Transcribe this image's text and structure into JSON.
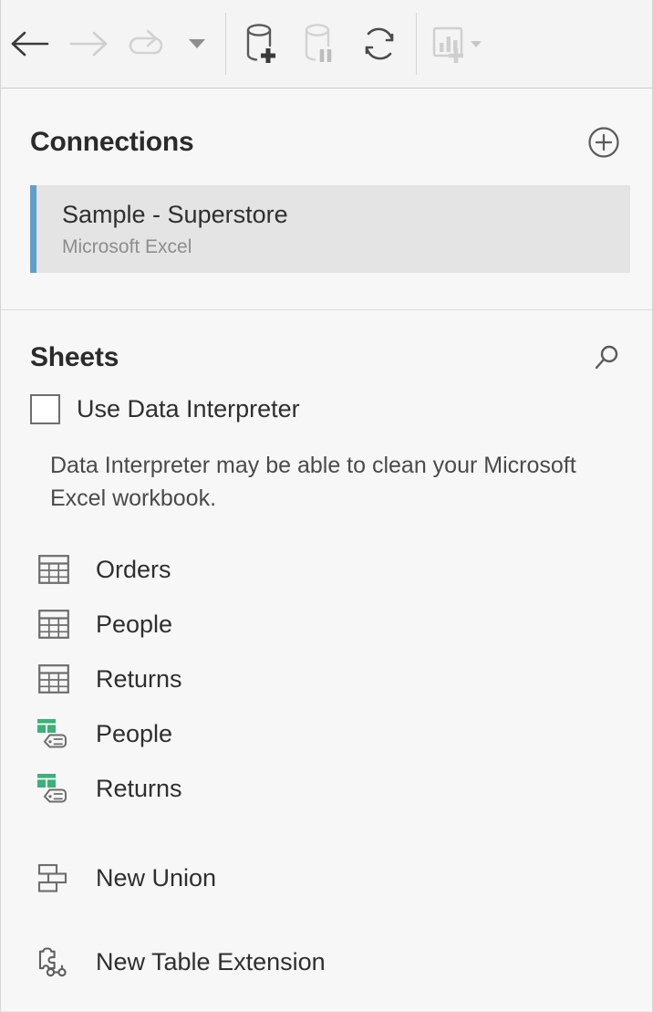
{
  "toolbar": {
    "buttons": [
      {
        "name": "back",
        "icon": "arrow-left-icon",
        "enabled": true
      },
      {
        "name": "forward",
        "icon": "arrow-right-icon",
        "enabled": false
      },
      {
        "name": "refresh-data-source",
        "icon": "redo-arrow-icon",
        "enabled": false
      },
      {
        "name": "refresh-dropdown",
        "icon": "caret-down-icon",
        "enabled": true
      },
      {
        "name": "add-new-data-source",
        "icon": "database-plus-icon",
        "enabled": true
      },
      {
        "name": "pause-auto-update",
        "icon": "database-pause-icon",
        "enabled": false
      },
      {
        "name": "refresh-data",
        "icon": "refresh-circular-icon",
        "enabled": true
      },
      {
        "name": "new-worksheet",
        "icon": "new-worksheet-icon",
        "enabled": false
      }
    ]
  },
  "connections": {
    "title": "Connections",
    "add_button_icon": "plus-circle-icon",
    "items": [
      {
        "name": "Sample - Superstore",
        "type": "Microsoft Excel",
        "selected": true
      }
    ]
  },
  "sheets": {
    "title": "Sheets",
    "search_icon": "search-icon",
    "data_interpreter": {
      "label": "Use Data Interpreter",
      "checked": false,
      "hint": "Data Interpreter may be able to clean your Microsoft Excel workbook."
    },
    "tables": [
      {
        "label": "Orders",
        "icon": "table-icon"
      },
      {
        "label": "People",
        "icon": "table-icon"
      },
      {
        "label": "Returns",
        "icon": "table-icon"
      },
      {
        "label": "People",
        "icon": "named-range-icon"
      },
      {
        "label": "Returns",
        "icon": "named-range-icon"
      }
    ],
    "actions": [
      {
        "label": "New Union",
        "icon": "union-icon"
      },
      {
        "label": "New Table Extension",
        "icon": "table-extension-icon"
      }
    ]
  },
  "colors": {
    "accent_blue": "#5e9fca",
    "named_range_green": "#3cb179",
    "panel_background": "#f7f7f7",
    "toolbar_background": "#f4f4f4",
    "selected_row": "#e4e4e4",
    "icon_gray": "#6d6d6d",
    "icon_disabled": "#cfcfcf"
  }
}
